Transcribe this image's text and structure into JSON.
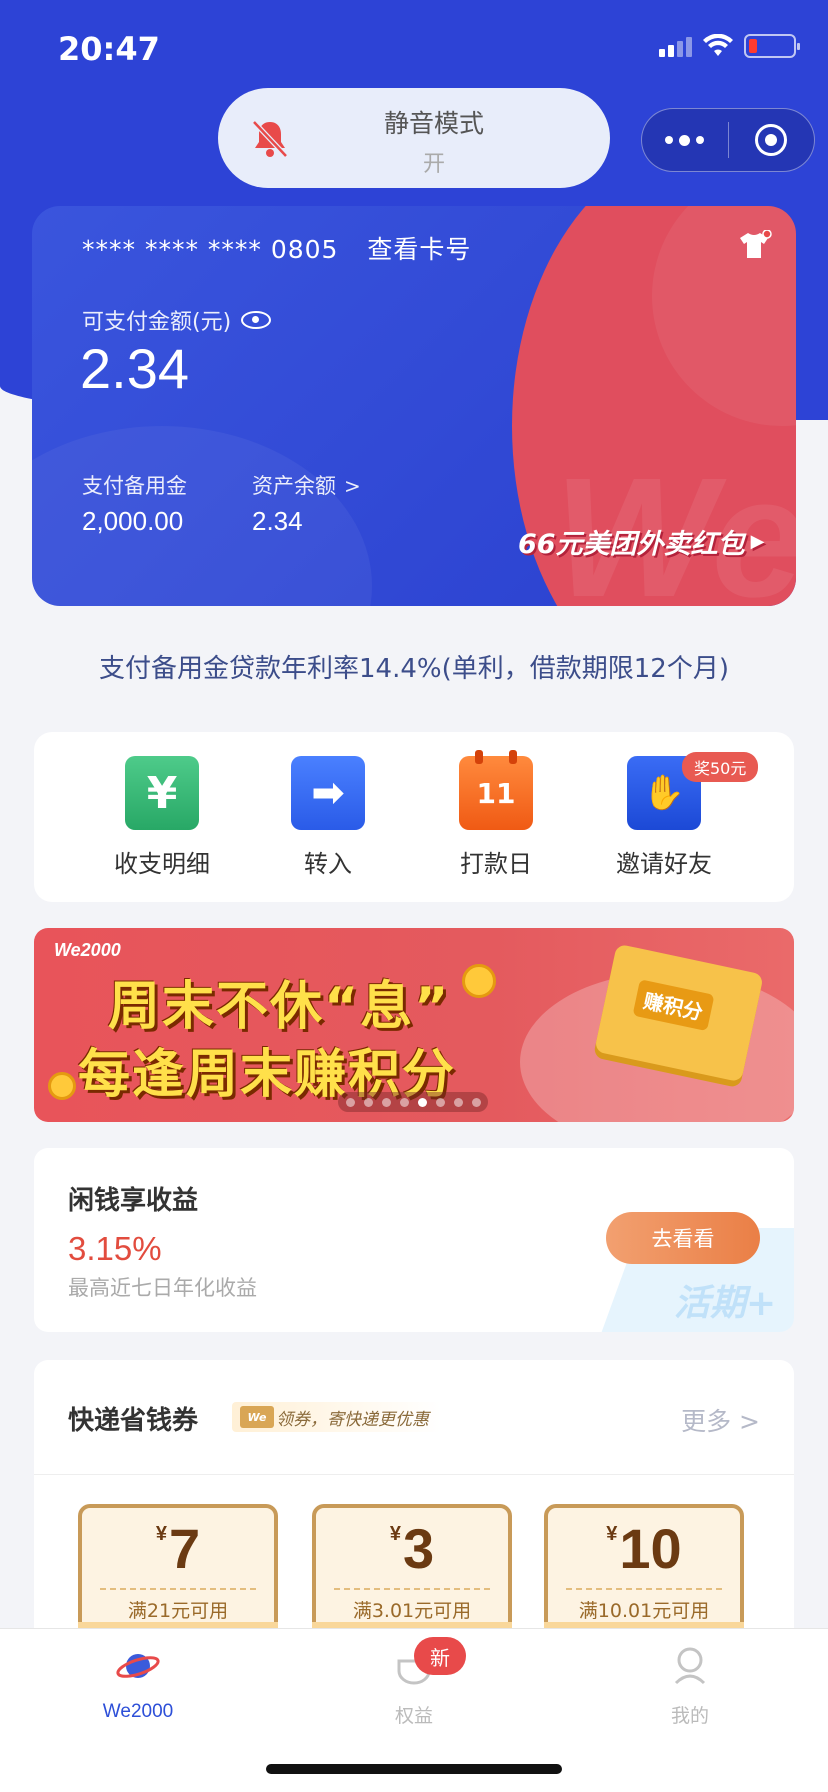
{
  "status_bar": {
    "time": "20:47"
  },
  "silent_mode": {
    "title": "静音模式",
    "state": "开"
  },
  "card": {
    "number_masked": "**** **** **** 0805",
    "view_number": "查看卡号",
    "available_label": "可支付金额(元)",
    "available_value": "2.34",
    "reserve_label": "支付备用金",
    "reserve_value": "2,000.00",
    "balance_label": "资产余额",
    "balance_value": "2.34",
    "promo": "66元美团外卖红包"
  },
  "rate_note": "支付备用金贷款年利率14.4%(单利，借款期限12个月)",
  "actions": [
    {
      "label": "收支明细",
      "icon": "yen-icon",
      "glyph": "¥"
    },
    {
      "label": "转入",
      "icon": "arrow-right-icon",
      "glyph": "➡"
    },
    {
      "label": "打款日",
      "icon": "calendar-icon",
      "glyph": "11"
    },
    {
      "label": "邀请好友",
      "icon": "handshake-icon",
      "glyph": "✋",
      "badge": "奖50元"
    }
  ],
  "banner": {
    "brand": "We2000",
    "line1": "周末不休“息”",
    "line2": "每逢周末赚积分",
    "box_label": "赚积分",
    "active_slide": 5,
    "slide_count": 8
  },
  "savings": {
    "title": "闲钱享收益",
    "rate": "3.15%",
    "desc": "最高近七日年化收益",
    "button": "去看看",
    "watermark": "活期+"
  },
  "express": {
    "title": "快递省钱券",
    "tag": "领券，寄快递更优惠",
    "tag_logo": "We",
    "more": "更多",
    "coupons": [
      {
        "currency": "¥",
        "amount": "7",
        "condition": "满21元可用"
      },
      {
        "currency": "¥",
        "amount": "3",
        "condition": "满3.01元可用"
      },
      {
        "currency": "¥",
        "amount": "10",
        "condition": "满10.01元可用"
      }
    ]
  },
  "tabbar": {
    "tabs": [
      {
        "label": "We2000",
        "icon": "planet-icon",
        "active": true
      },
      {
        "label": "权益",
        "icon": "gift-cup-icon",
        "badge": "新"
      },
      {
        "label": "我的",
        "icon": "user-icon"
      }
    ]
  },
  "colors": {
    "primary": "#2d43d6",
    "accent_red": "#e04e5e",
    "rate_red": "#e24c3e",
    "tab_active": "#2d4fd8"
  }
}
